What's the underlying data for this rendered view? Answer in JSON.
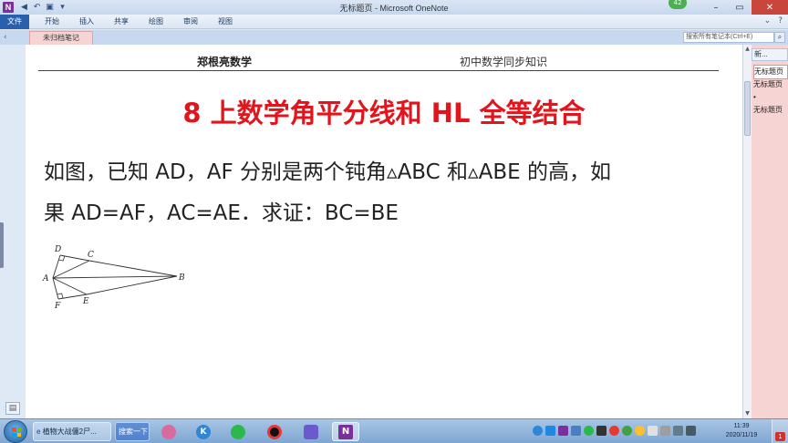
{
  "window": {
    "title": "无标题页 - Microsoft OneNote",
    "notification_count": "42"
  },
  "ribbon": {
    "tabs": [
      "文件",
      "开始",
      "插入",
      "共享",
      "绘图",
      "审阅",
      "视图"
    ]
  },
  "notebook": {
    "section_tab": "未归档笔记",
    "search_placeholder": "搜索所有笔记本(Ctrl+E)"
  },
  "page": {
    "header_left": "郑根亮数学",
    "header_right": "初中数学同步知识",
    "title": "8 上数学角平分线和 HL 全等结合",
    "problem_line1": "如图，已知 AD，AF 分别是两个钝角▵ABC 和▵ABE 的高，如",
    "problem_line2": "果 AD=AF，AC=AE．求证：BC=BE",
    "figure_labels": {
      "A": "A",
      "B": "B",
      "C": "C",
      "D": "D",
      "E": "E",
      "F": "F"
    }
  },
  "page_pane": {
    "new_page": "新...",
    "pages": [
      "无标题页",
      "无标题页",
      "•",
      "无标题页"
    ]
  },
  "taskbar": {
    "window_label": "植物大战僵2尸...",
    "search_button": "搜索一下",
    "time": "11:39",
    "date": "2020/11/19",
    "badge": "1"
  }
}
